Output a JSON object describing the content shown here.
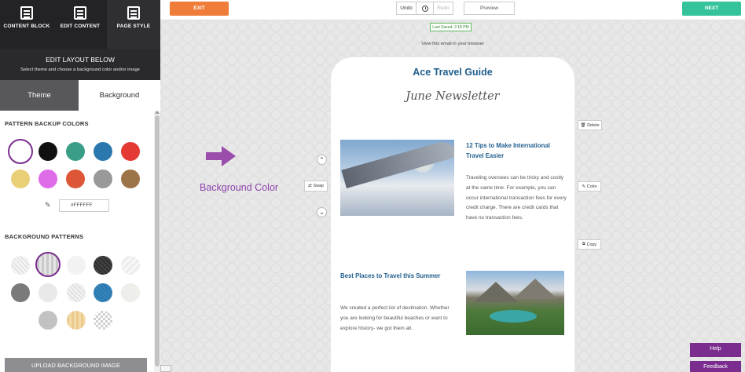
{
  "modes": [
    {
      "label": "CONTENT BLOCK",
      "active": true
    },
    {
      "label": "EDIT CONTENT",
      "active": true
    },
    {
      "label": "PAGE STYLE",
      "active": false
    }
  ],
  "layout_header": {
    "title": "EDIT LAYOUT BELOW",
    "subtitle": "Select theme and choose a background color and/or image"
  },
  "tabs": {
    "theme": "Theme",
    "background": "Background"
  },
  "pattern_backup_colors": {
    "title": "PATTERN BACKUP COLORS",
    "swatches": [
      "#ffffff",
      "#111111",
      "#3a9e87",
      "#2b78ae",
      "#e53935",
      "#e9cf76",
      "#de6be8",
      "#dd5635",
      "#999999",
      "#9c7448"
    ],
    "selected_index": 0,
    "hex_value": "#FFFFFF"
  },
  "background_patterns": {
    "title": "BACKGROUND PATTERNS",
    "selected_index": 1
  },
  "upload_button": "UPLOAD BACKGROUND IMAGE",
  "toolbar": {
    "exit": "EXIT",
    "undo": "Undo",
    "redo": "Redo",
    "preview": "Preview",
    "next": "NEXT"
  },
  "status": {
    "last_saved": "Last Saved: 2:18 PM",
    "browser_link": "View this email in your browser"
  },
  "annotation": {
    "label": "Background Color"
  },
  "email": {
    "title": "Ace Travel Guide",
    "subtitle": "June Newsletter",
    "article1": {
      "title": "12 Tips to Make International Travel Easier",
      "body": "Traveling oversees can be tricky and costly at the same time. For example, you can occur international transaction fees for every credit charge. There are credit cards that have no transaction fees."
    },
    "article2": {
      "title": "Best Places to Travel this Summer",
      "body": "We created a perfect list of destination.  Whether you are looking for beautiful beaches or want to explore history- we got them all."
    }
  },
  "block_controls": {
    "delete": "Delete",
    "swap": "Swap",
    "color": "Color",
    "copy": "Copy"
  },
  "footer_buttons": {
    "help": "Help",
    "feedback": "Feedback"
  },
  "colors": {
    "accent_purple": "#7b2d8f",
    "exit_orange": "#f07c3a",
    "next_green": "#34c39a",
    "email_blue": "#1f5d8c"
  }
}
